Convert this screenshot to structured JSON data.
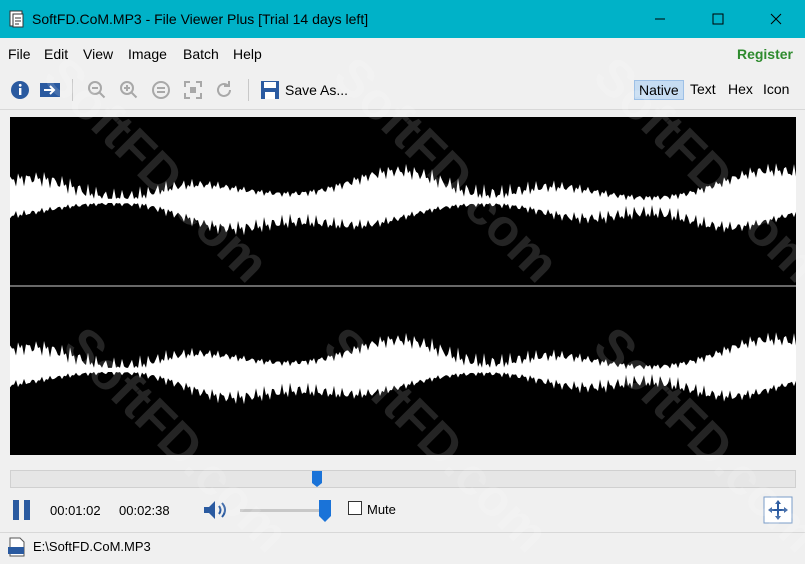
{
  "window": {
    "title": "SoftFD.CoM.MP3 - File Viewer Plus [Trial 14 days left]",
    "accent": "#00b2c8"
  },
  "menu": {
    "items": [
      "File",
      "Edit",
      "View",
      "Image",
      "Batch",
      "Help"
    ],
    "register": "Register"
  },
  "toolbar": {
    "save_as": "Save As...",
    "view_modes": [
      "Native",
      "Text",
      "Hex",
      "Icon"
    ],
    "active_mode": "Native"
  },
  "player": {
    "elapsed": "00:01:02",
    "duration": "00:02:38",
    "progress": 0.39,
    "volume": 1.0,
    "mute_label": "Mute",
    "muted": false
  },
  "status": {
    "path": "E:\\SoftFD.CoM.MP3"
  },
  "watermark": "SoftFD.com"
}
